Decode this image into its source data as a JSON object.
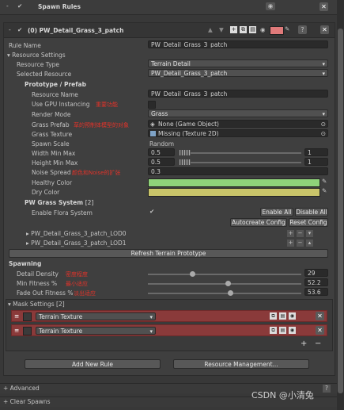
{
  "header": {
    "title": "Spawn Rules"
  },
  "rule": {
    "title": "(0) PW_Detail_Grass_3_patch",
    "name_label": "Rule Name",
    "name_value": "PW_Detail_Grass_3_patch",
    "color": "#e07a7a"
  },
  "resource": {
    "section_label": "Resource Settings",
    "type_label": "Resource Type",
    "type_value": "Terrain Detail",
    "selected_label": "Selected Resource",
    "selected_value": "PW_Detail_Grass_3_patch"
  },
  "prefab": {
    "section_label": "Prototype / Prefab",
    "name_label": "Resource Name",
    "name_value": "PW_Detail_Grass_3_patch",
    "gpu_label": "Use GPU Instancing",
    "gpu_note": "重要功能",
    "render_label": "Render Mode",
    "render_value": "Grass",
    "grass_prefab_label": "Grass Prefab",
    "grass_prefab_note": "草的预制体模型的对象",
    "grass_prefab_value": "None (Game Object)",
    "grass_texture_label": "Grass Texture",
    "grass_texture_value": "Missing (Texture 2D)",
    "spawn_scale_label": "Spawn Scale",
    "spawn_scale_value": "Random",
    "width_label": "Width Min Max",
    "width_min": "0.5",
    "width_max": "1",
    "height_label": "Height Min Max",
    "height_min": "0.5",
    "height_max": "1",
    "noise_label": "Noise Spread",
    "noise_note": "颜色和Noise的扩张",
    "noise_value": "0.3",
    "healthy_label": "Healthy Color",
    "healthy_color": "#8fd27a",
    "dry_label": "Dry Color",
    "dry_color": "#c9c46a"
  },
  "pw_grass": {
    "section_label": "PW Grass System",
    "count": "[2]",
    "flora_label": "Enable Flora System",
    "enable_all": "Enable All",
    "disable_all": "Disable All",
    "autocreate": "Autocreate Config",
    "reset": "Reset Config",
    "lod0": "PW_Detail_Grass_3_patch_LOD0",
    "lod1": "PW_Detail_Grass_3_patch_LOD1"
  },
  "refresh_button": "Refresh Terrain Prototype",
  "spawning": {
    "section_label": "Spawning",
    "density_label": "Detail Density",
    "density_note": "密度程度",
    "density_value": "29",
    "density_fraction": 0.29,
    "min_fitness_label": "Min Fitness %",
    "min_fitness_note": "最小适应",
    "min_fitness_value": "52.2",
    "min_fitness_fraction": 0.522,
    "fade_label": "Fade Out Fitness %",
    "fade_note": "淡出适应",
    "fade_value": "53.6",
    "fade_fraction": 0.536
  },
  "mask": {
    "section_label": "Mask Settings",
    "count": "[2]",
    "rows": [
      {
        "value": "Terrain Texture"
      },
      {
        "value": "Terrain Texture"
      }
    ],
    "add": "+",
    "remove": "−"
  },
  "footer": {
    "add_rule": "Add New Rule",
    "resource_mgmt": "Resource Management...",
    "advanced": "Advanced",
    "clear_spawns": "Clear Spawns"
  },
  "watermark": "CSDN @小清兔"
}
